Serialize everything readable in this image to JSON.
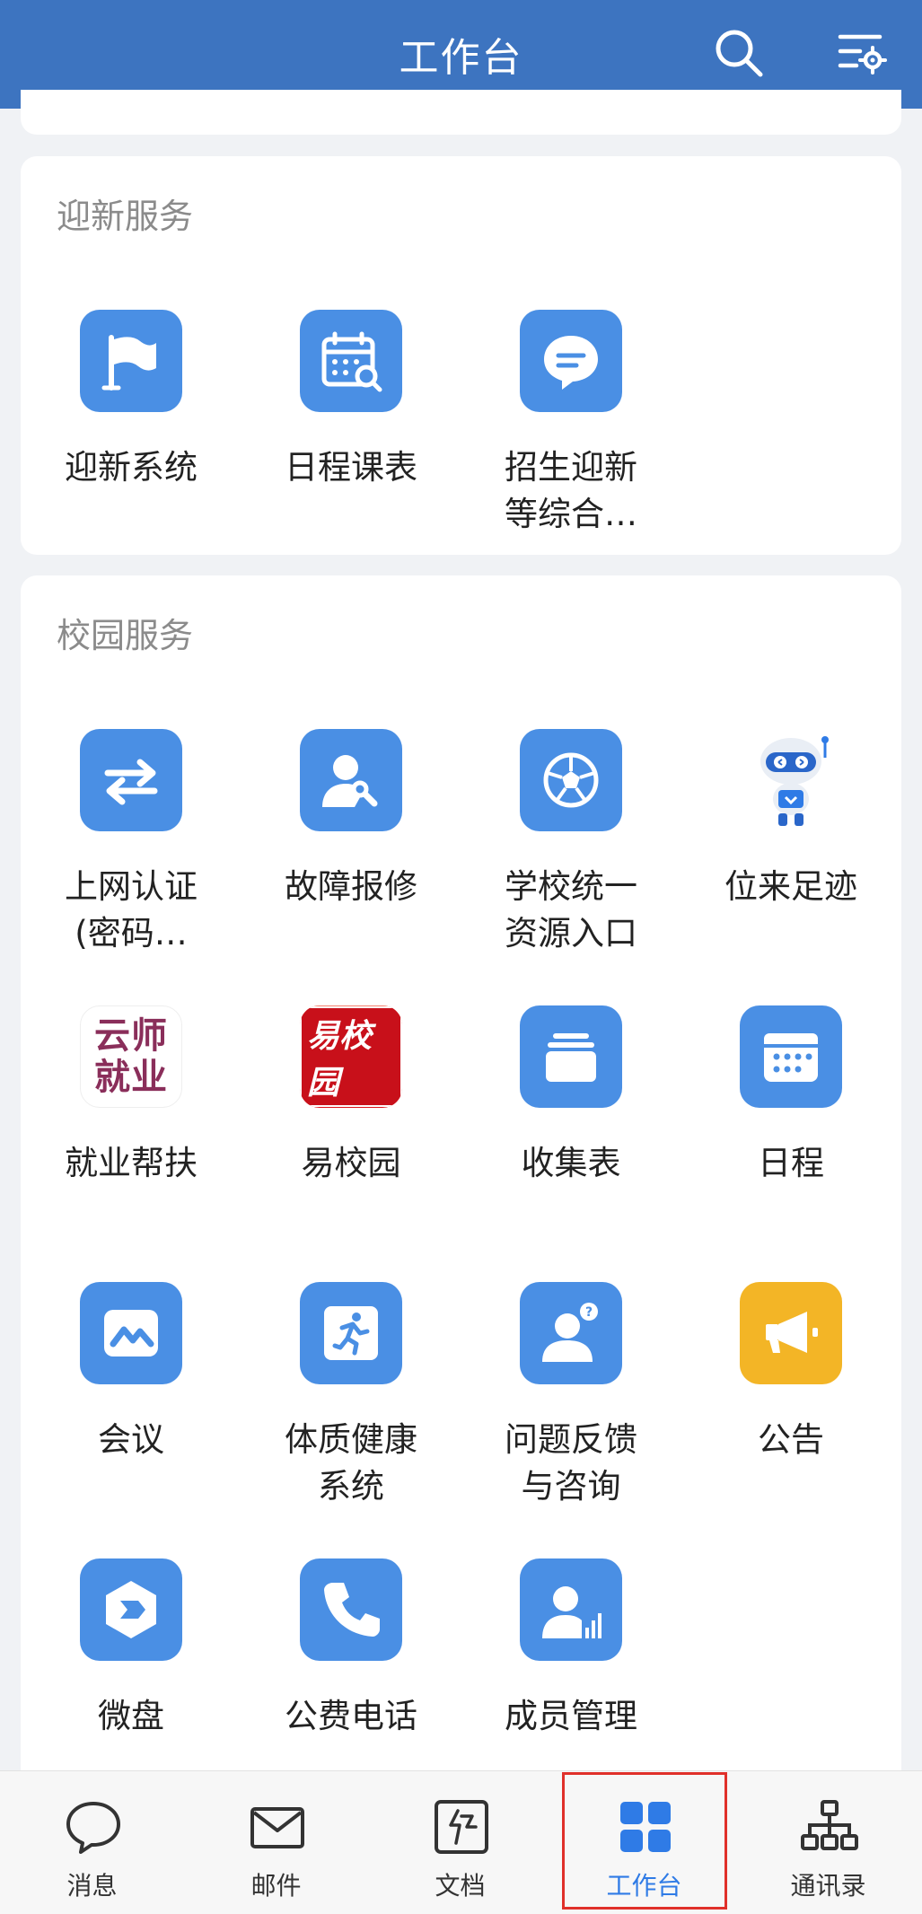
{
  "header": {
    "title": "工作台",
    "search_icon": "search-icon",
    "settings_icon": "list-settings-icon"
  },
  "sections": [
    {
      "title": "迎新服务",
      "apps": [
        {
          "line1": "迎新系统",
          "line2": "",
          "icon": "flag-icon"
        },
        {
          "line1": "日程课表",
          "line2": "",
          "icon": "calendar-search-icon"
        },
        {
          "line1": "招生迎新",
          "line2": "等综合…",
          "icon": "chat-bubble-icon"
        }
      ]
    },
    {
      "title": "校园服务",
      "apps": [
        {
          "line1": "上网认证",
          "line2": "(密码…",
          "icon": "swap-arrows-icon"
        },
        {
          "line1": "故障报修",
          "line2": "",
          "icon": "user-wrench-icon"
        },
        {
          "line1": "学校统一",
          "line2": "资源入口",
          "icon": "football-icon"
        },
        {
          "line1": "位来足迹",
          "line2": "",
          "icon": "robot-mascot-icon"
        },
        {
          "line1": "就业帮扶",
          "line2": "",
          "icon": "yunshi-jiuye-logo",
          "logo_text_1": "云师",
          "logo_text_2": "就业"
        },
        {
          "line1": "易校园",
          "line2": "",
          "icon": "yixiaoyuan-logo",
          "logo_text": "易校园"
        },
        {
          "line1": "收集表",
          "line2": "",
          "icon": "collection-form-icon"
        },
        {
          "line1": "日程",
          "line2": "",
          "icon": "calendar-icon"
        },
        {
          "line1": "会议",
          "line2": "",
          "icon": "meeting-icon"
        },
        {
          "line1": "体质健康",
          "line2": "系统",
          "icon": "running-person-icon"
        },
        {
          "line1": "问题反馈",
          "line2": "与咨询",
          "icon": "user-question-icon"
        },
        {
          "line1": "公告",
          "line2": "",
          "icon": "megaphone-icon"
        },
        {
          "line1": "微盘",
          "line2": "",
          "icon": "cloud-disk-icon"
        },
        {
          "line1": "公费电话",
          "line2": "",
          "icon": "phone-icon"
        },
        {
          "line1": "成员管理",
          "line2": "",
          "icon": "user-chart-icon"
        }
      ]
    }
  ],
  "tabs": [
    {
      "label": "消息",
      "icon": "message-icon",
      "active": false
    },
    {
      "label": "邮件",
      "icon": "mail-icon",
      "active": false
    },
    {
      "label": "文档",
      "icon": "document-icon",
      "active": false
    },
    {
      "label": "工作台",
      "icon": "workbench-grid-icon",
      "active": true
    },
    {
      "label": "通讯录",
      "icon": "contacts-org-icon",
      "active": false
    }
  ],
  "colors": {
    "header": "#3d74c0",
    "tile": "#4a8fe4",
    "announcement": "#f3b526",
    "active_tab": "#2f7be6",
    "highlight_box": "#e0302a"
  }
}
